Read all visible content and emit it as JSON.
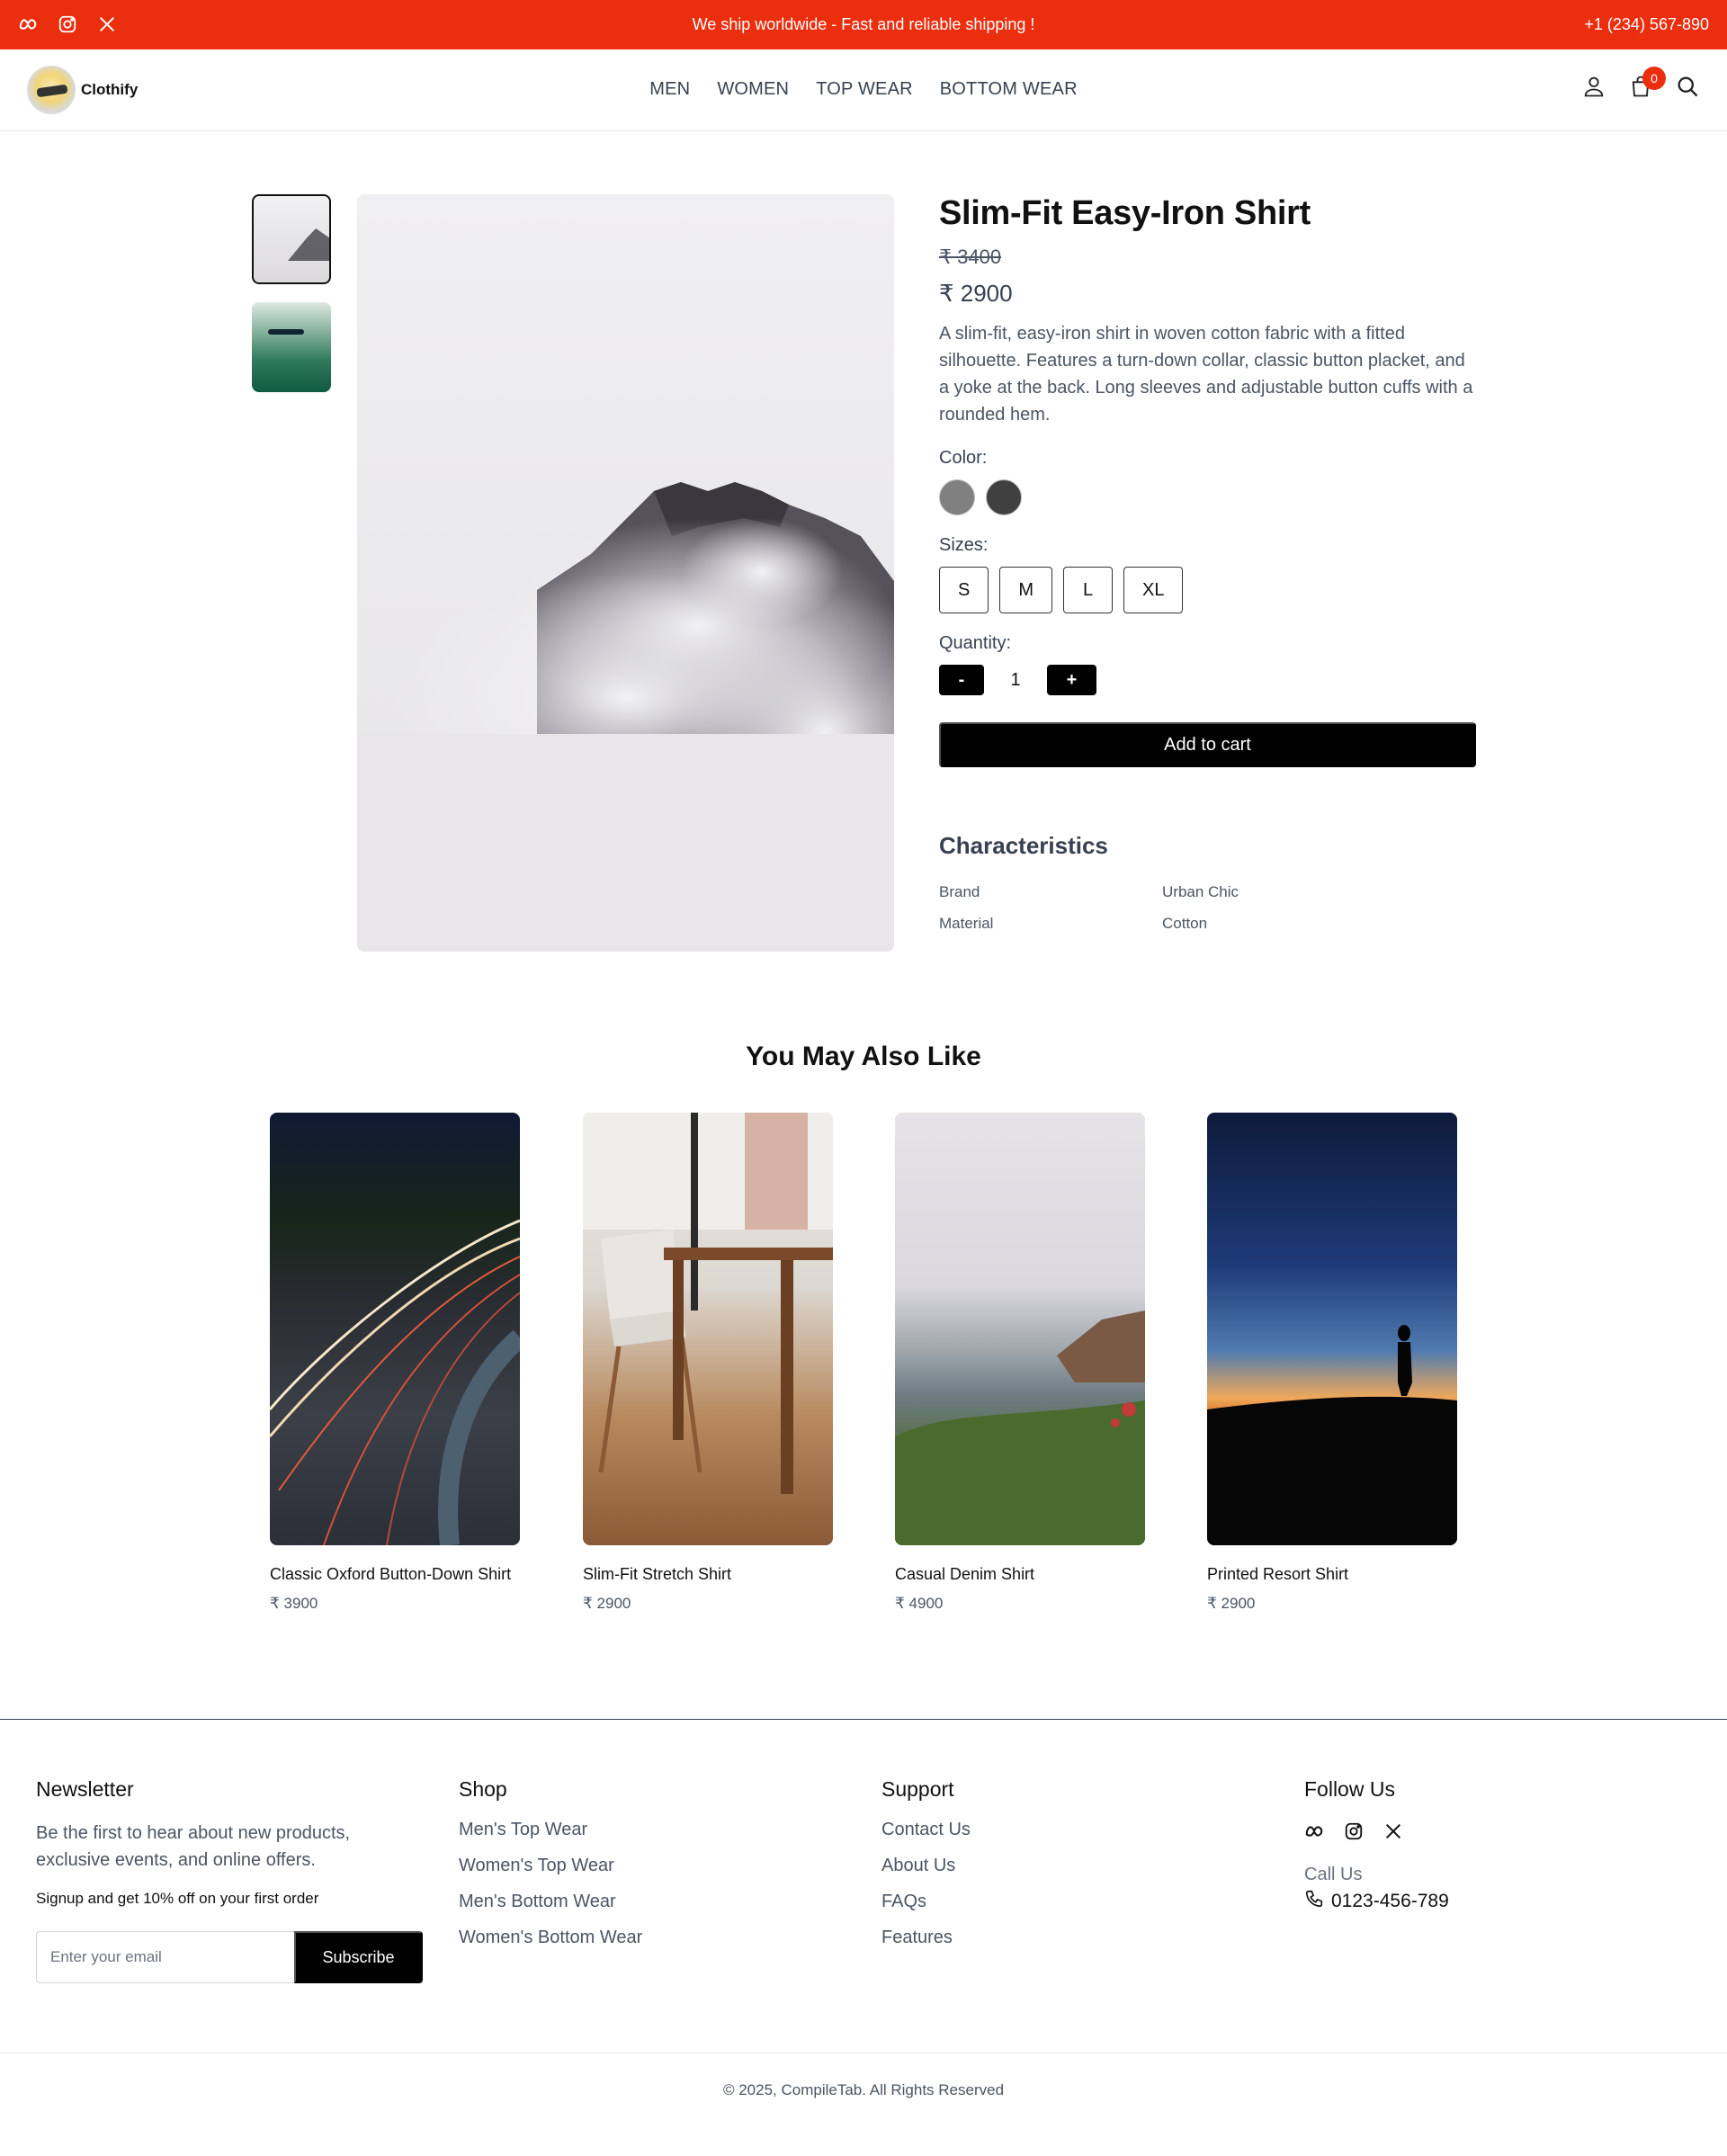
{
  "topbar": {
    "promo": "We ship worldwide - Fast and reliable shipping !",
    "phone": "+1 (234) 567-890",
    "socials": [
      "meta-icon",
      "instagram-icon",
      "x-icon"
    ],
    "color": "#ea2e0e"
  },
  "header": {
    "brand": "Clothify",
    "nav": [
      "MEN",
      "WOMEN",
      "TOP WEAR",
      "BOTTOM WEAR"
    ],
    "cart_count": "0",
    "icons": [
      "user-icon",
      "cart-icon",
      "search-icon"
    ]
  },
  "product": {
    "title": "Slim-Fit Easy-Iron Shirt",
    "old_price": "₹ 3400",
    "price": "₹ 2900",
    "description": "A slim-fit, easy-iron shirt in woven cotton fabric with a fitted silhouette. Features a turn-down collar, classic button placket, and a yoke at the back. Long sleeves and adjustable button cuffs with a rounded hem.",
    "color_label": "Color:",
    "colors": [
      "#808080",
      "#404040"
    ],
    "sizes_label": "Sizes:",
    "sizes": [
      "S",
      "M",
      "L",
      "XL"
    ],
    "quantity_label": "Quantity:",
    "quantity": "1",
    "minus": "-",
    "plus": "+",
    "add_to_cart": "Add to cart",
    "characteristics_title": "Characteristics",
    "characteristics": [
      {
        "key": "Brand",
        "value": "Urban Chic"
      },
      {
        "key": "Material",
        "value": "Cotton"
      }
    ]
  },
  "related": {
    "title": "You May Also Like",
    "items": [
      {
        "name": "Classic Oxford Button-Down Shirt",
        "price": "₹ 3900"
      },
      {
        "name": "Slim-Fit Stretch Shirt",
        "price": "₹ 2900"
      },
      {
        "name": "Casual Denim Shirt",
        "price": "₹ 4900"
      },
      {
        "name": "Printed Resort Shirt",
        "price": "₹ 2900"
      }
    ]
  },
  "footer": {
    "newsletter": {
      "title": "Newsletter",
      "text": "Be the first to hear about new products, exclusive events, and online offers.",
      "offer": "Signup and get 10% off on your first order",
      "placeholder": "Enter your email",
      "button": "Subscribe"
    },
    "shop": {
      "title": "Shop",
      "links": [
        "Men's Top Wear",
        "Women's Top Wear",
        "Men's Bottom Wear",
        "Women's Bottom Wear"
      ]
    },
    "support": {
      "title": "Support",
      "links": [
        "Contact Us",
        "About Us",
        "FAQs",
        "Features"
      ]
    },
    "follow": {
      "title": "Follow Us",
      "call_label": "Call Us",
      "phone": "0123-456-789"
    },
    "copyright": "© 2025, CompileTab. All Rights Reserved"
  }
}
